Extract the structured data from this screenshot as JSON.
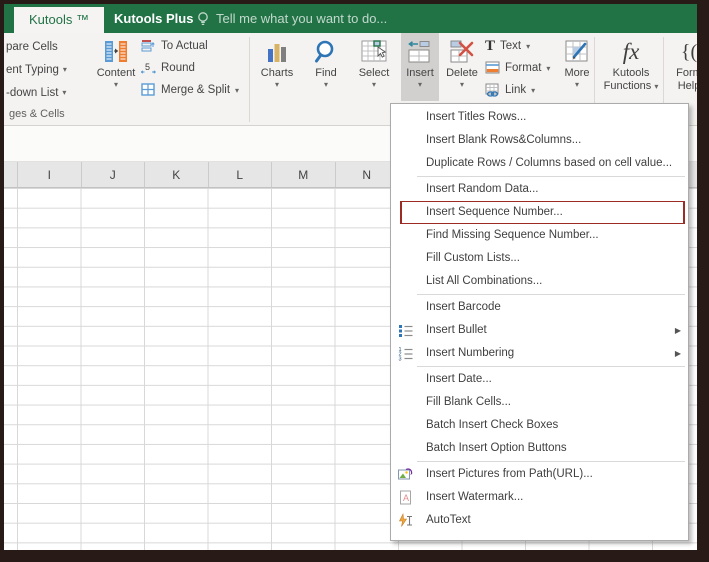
{
  "colors": {
    "excel_green": "#217346",
    "highlight_red": "#9c2b23",
    "pressed_button_bg": "#d2d0ce"
  },
  "tabbar": {
    "kutools_tab": "Kutools ™",
    "kutools_plus_tab": "Kutools Plus",
    "tell_me": "Tell me what you want to do..."
  },
  "ribbon": {
    "truncated_row1": "pare Cells",
    "truncated_row2": "ent Typing",
    "truncated_row3": "-down List",
    "content": "Content",
    "to_actual": "To Actual",
    "round": "Round",
    "merge_split": "Merge & Split",
    "charts": "Charts",
    "find": "Find",
    "select": "Select",
    "insert": "Insert",
    "delete": "Delete",
    "text": "Text",
    "format": "Format",
    "link": "Link",
    "more": "More",
    "kutools_functions_line1": "Kutools",
    "kutools_functions_line2": "Functions",
    "form_help_line1": "Form",
    "form_help_line2": "Help",
    "group_label": "ges & Cells"
  },
  "sheet": {
    "column_headers": [
      "I",
      "J",
      "K",
      "L",
      "M",
      "N"
    ]
  },
  "menu": {
    "items": [
      {
        "label": "Insert Titles Rows..."
      },
      {
        "label": "Insert Blank Rows&Columns..."
      },
      {
        "label": "Duplicate Rows / Columns based on cell value..."
      },
      {
        "label": "Insert Random Data..."
      },
      {
        "label": "Insert Sequence Number..."
      },
      {
        "label": "Find Missing Sequence Number..."
      },
      {
        "label": "Fill Custom Lists..."
      },
      {
        "label": "List All Combinations..."
      },
      {
        "label": "Insert Barcode"
      },
      {
        "label": "Insert Bullet"
      },
      {
        "label": "Insert Numbering"
      },
      {
        "label": "Insert Date..."
      },
      {
        "label": "Fill Blank Cells..."
      },
      {
        "label": "Batch Insert Check Boxes"
      },
      {
        "label": "Batch Insert Option Buttons"
      },
      {
        "label": "Insert Pictures from Path(URL)..."
      },
      {
        "label": "Insert Watermark..."
      },
      {
        "label": "AutoText"
      }
    ]
  }
}
